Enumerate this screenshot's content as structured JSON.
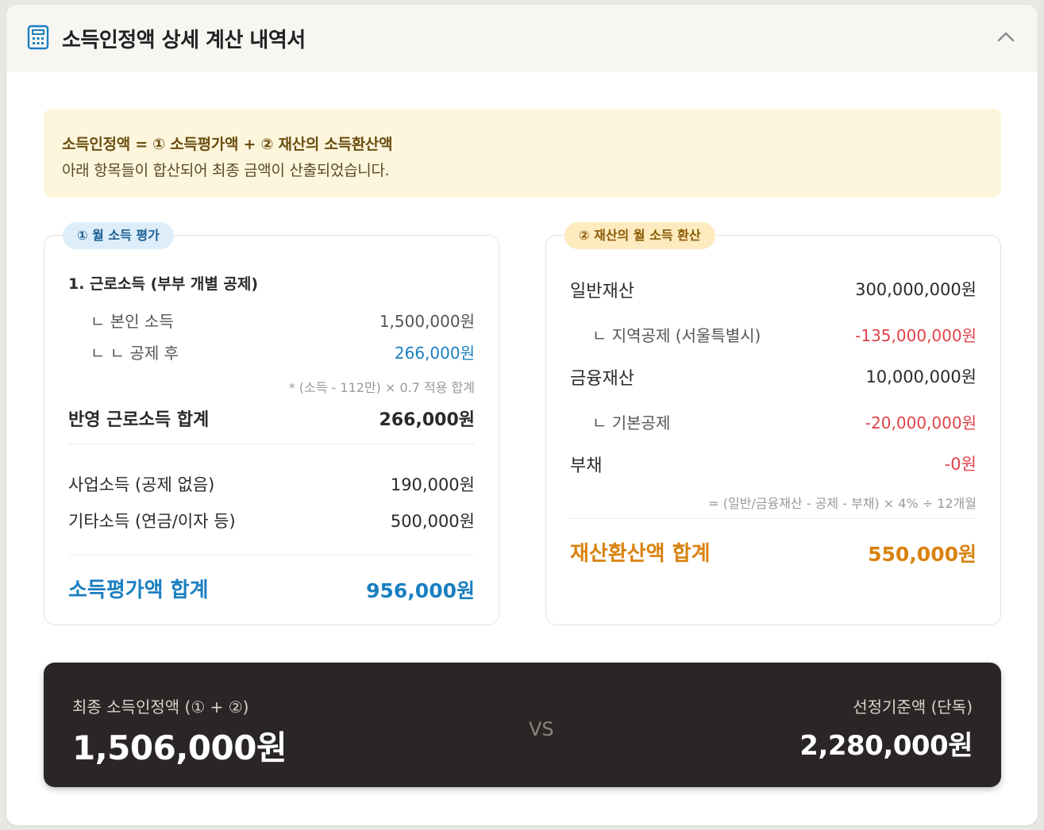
{
  "header": {
    "title": "소득인정액 상세 계산 내역서",
    "icon": "calculator-icon",
    "collapse_icon": "chevron-up-icon",
    "accent": "#1a7fc0"
  },
  "formula": {
    "line1": "소득인정액 = ① 소득평가액 + ② 재산의 소득환산액",
    "line2": "아래 항목들이 합산되어 최종 금액이 산출되었습니다."
  },
  "income": {
    "badge": "① 월 소득 평가",
    "earned_heading": "1. 근로소득 (부부 개별 공제)",
    "self_income_label": "ㄴ 본인 소득",
    "self_income_value": "1,500,000원",
    "after_deduction_label": "ㄴ ㄴ 공제 후",
    "after_deduction_value": "266,000원",
    "note": "* (소득 - 112만) × 0.7 적용 합계",
    "earned_total_label": "반영 근로소득 합계",
    "earned_total_value": "266,000원",
    "business_label": "사업소득 (공제 없음)",
    "business_value": "190,000원",
    "other_label": "기타소득 (연금/이자 등)",
    "other_value": "500,000원",
    "total_label": "소득평가액 합계",
    "total_value": "956,000원"
  },
  "property": {
    "badge": "② 재산의 월 소득 환산",
    "general_label": "일반재산",
    "general_value": "300,000,000원",
    "regional_label": "ㄴ 지역공제 (서울특별시)",
    "regional_value": "-135,000,000원",
    "financial_label": "금융재산",
    "financial_value": "10,000,000원",
    "basic_label": "ㄴ 기본공제",
    "basic_value": "-20,000,000원",
    "debt_label": "부채",
    "debt_value": "-0원",
    "note": "= (일반/금융재산 - 공제 - 부채) × 4% ÷ 12개월",
    "total_label": "재산환산액 합계",
    "total_value": "550,000원"
  },
  "summary": {
    "final_label": "최종 소득인정액 (① + ②)",
    "final_value": "1,506,000원",
    "vs": "VS",
    "standard_label": "선정기준액 (단독)",
    "standard_value": "2,280,000원"
  }
}
